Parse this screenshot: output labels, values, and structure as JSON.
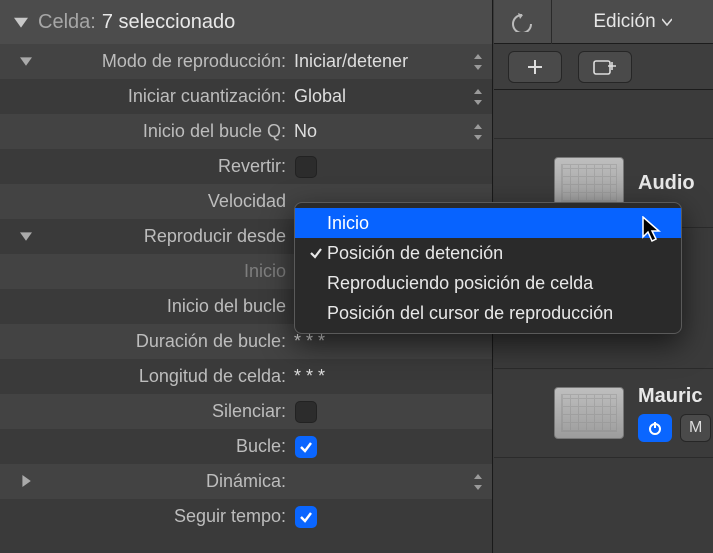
{
  "header": {
    "prefix": "Celda:",
    "value": "7 seleccionado"
  },
  "rows": {
    "modo": {
      "label": "Modo de reproducción:",
      "value": "Iniciar/detener"
    },
    "cuant": {
      "label": "Iniciar cuantización:",
      "value": "Global"
    },
    "bucleq": {
      "label": "Inicio del bucle Q:",
      "value": "No"
    },
    "revertir": {
      "label": "Revertir:"
    },
    "velocidad": {
      "label": "Velocidad"
    },
    "desde": {
      "label": "Reproducir desde"
    },
    "inicio": {
      "label": "Inicio"
    },
    "iniciob": {
      "label": "Inicio del bucle"
    },
    "durb": {
      "label": "Duración de bucle:",
      "value": "*  *  *"
    },
    "longc": {
      "label": "Longitud de celda:",
      "value": "*  *  *"
    },
    "silenciar": {
      "label": "Silenciar:"
    },
    "bucle": {
      "label": "Bucle:"
    },
    "dinamica": {
      "label": "Dinámica:"
    },
    "seguir": {
      "label": "Seguir tempo:"
    }
  },
  "menu": {
    "items": [
      "Inicio",
      "Posición de detención",
      "Reproduciendo posición de celda",
      "Posición del cursor de reproducción"
    ],
    "highlighted": 0,
    "checked": 1
  },
  "right": {
    "edicion": "Edición",
    "item1_title": "Audio",
    "item2_title": "Mauric",
    "m_label": "M"
  }
}
